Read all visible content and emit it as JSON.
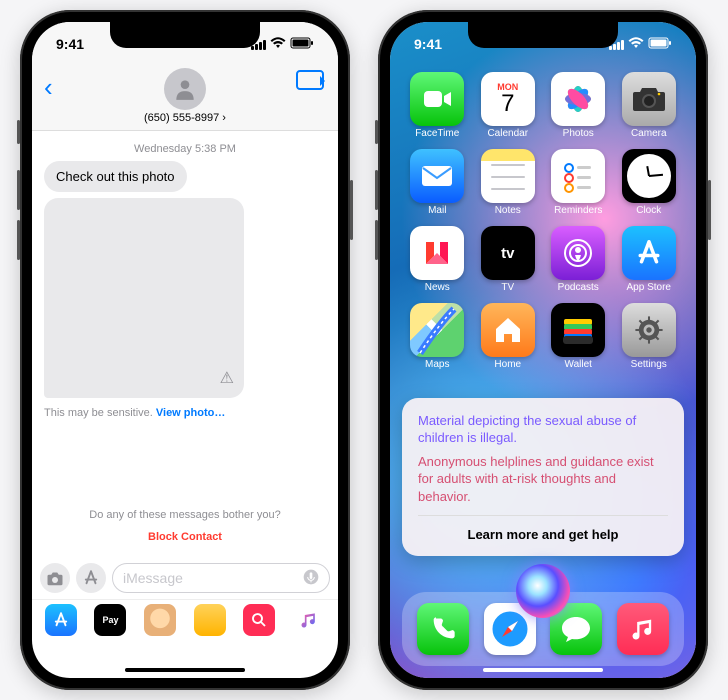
{
  "status": {
    "time": "9:41"
  },
  "left": {
    "contact_number": "(650) 555-8997 ›",
    "timestamp": "Wednesday 5:38 PM",
    "message_text": "Check out this photo",
    "sensitive_prefix": "This may be sensitive. ",
    "sensitive_link": "View photo…",
    "bother_prompt": "Do any of these messages bother you?",
    "block_label": "Block Contact",
    "input_placeholder": "iMessage"
  },
  "right": {
    "calendar_dow": "MON",
    "calendar_day": "7",
    "apps": [
      "FaceTime",
      "Calendar",
      "Photos",
      "Camera",
      "Mail",
      "Notes",
      "Reminders",
      "Clock",
      "News",
      "TV",
      "Podcasts",
      "App Store",
      "Maps",
      "Home",
      "Wallet",
      "Settings"
    ],
    "siri_p1": "Material depicting the sexual abuse of children is illegal.",
    "siri_p2": "Anonymous helplines and guidance exist for adults with at-risk thoughts and behavior.",
    "siri_learn": "Learn more and get help"
  }
}
